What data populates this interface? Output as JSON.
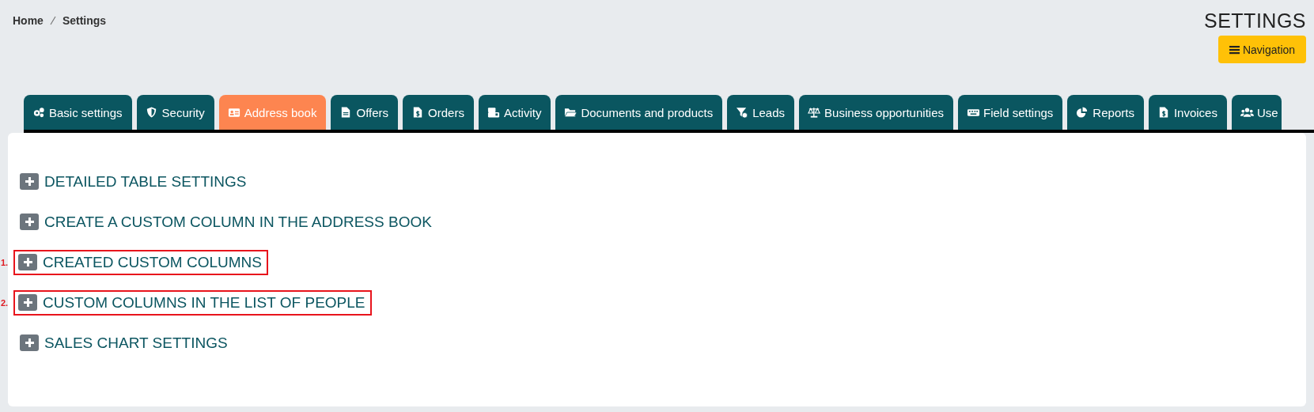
{
  "breadcrumb": [
    "Home",
    "Settings"
  ],
  "page_title": "SETTINGS",
  "navigation_button": "Navigation",
  "tabs": [
    {
      "label": "Basic settings",
      "selected": false
    },
    {
      "label": "Security",
      "selected": false
    },
    {
      "label": "Address book",
      "selected": true
    },
    {
      "label": "Offers",
      "selected": false
    },
    {
      "label": "Orders",
      "selected": false
    },
    {
      "label": "Activity",
      "selected": false
    },
    {
      "label": "Documents and products",
      "selected": false
    },
    {
      "label": "Leads",
      "selected": false
    },
    {
      "label": "Business opportunities",
      "selected": false
    },
    {
      "label": "Field settings",
      "selected": false
    },
    {
      "label": "Reports",
      "selected": false
    },
    {
      "label": "Invoices",
      "selected": false
    },
    {
      "label": "Use",
      "selected": false
    }
  ],
  "sections": [
    {
      "title": "DETAILED TABLE SETTINGS",
      "expanded": false,
      "highlighted": false
    },
    {
      "title": "CREATE A CUSTOM COLUMN IN THE ADDRESS BOOK",
      "expanded": false,
      "highlighted": false
    },
    {
      "title": "CREATED CUSTOM COLUMNS",
      "expanded": false,
      "highlighted": true,
      "marker": "1."
    },
    {
      "title": "CUSTOM COLUMNS IN THE LIST OF PEOPLE",
      "expanded": false,
      "highlighted": true,
      "marker": "2."
    },
    {
      "title": "SALES CHART SETTINGS",
      "expanded": false,
      "highlighted": false
    }
  ]
}
